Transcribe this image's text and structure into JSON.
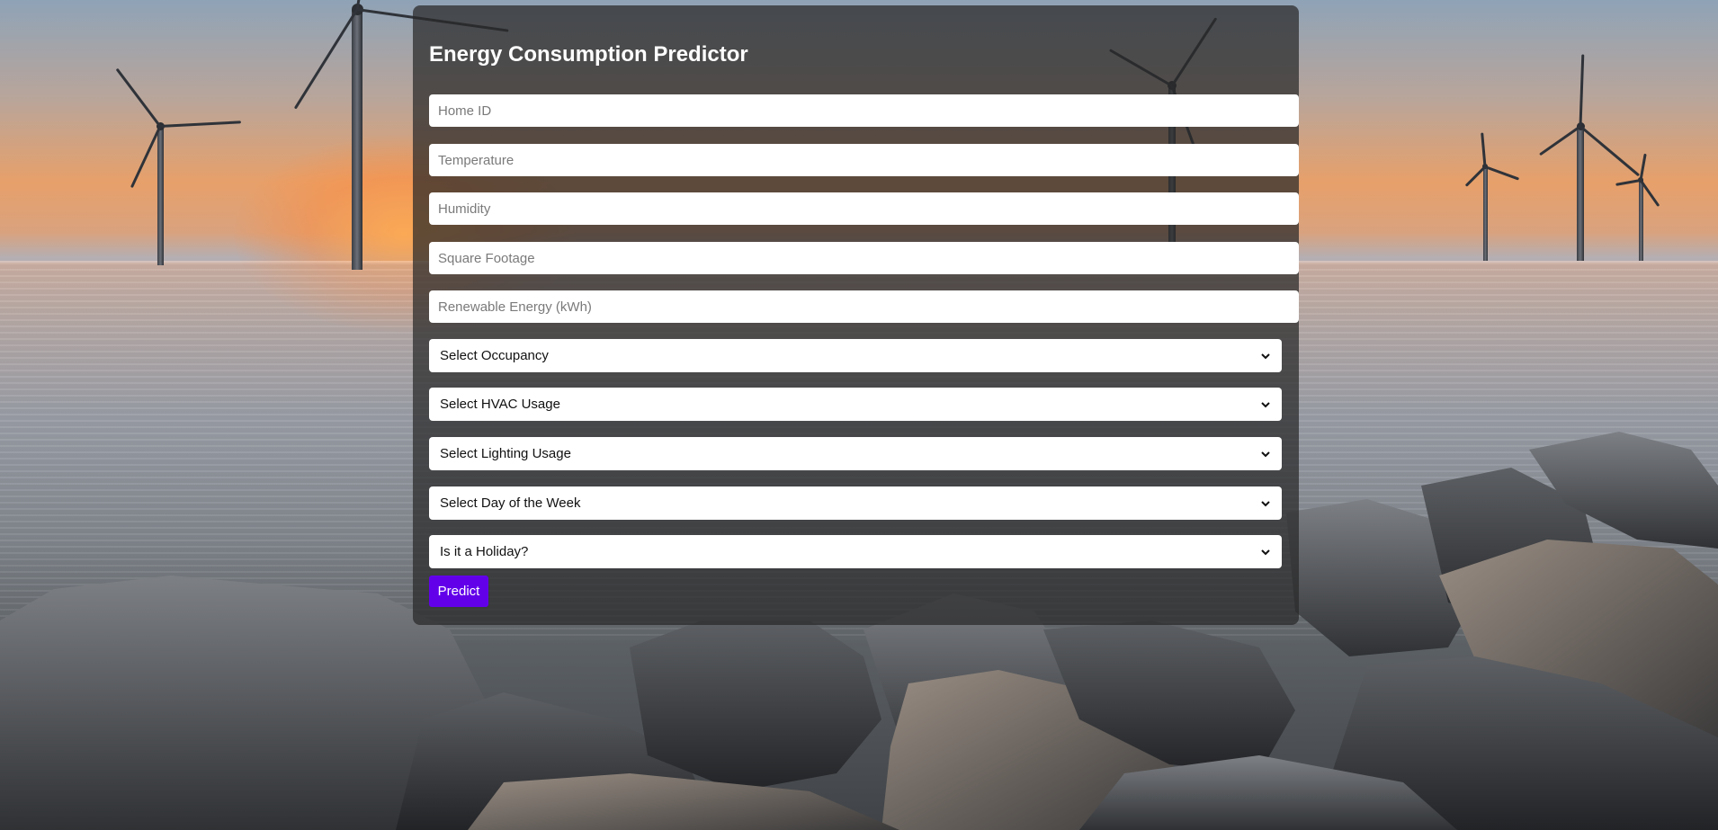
{
  "form": {
    "title": "Energy Consumption Predictor",
    "inputs": [
      {
        "placeholder": "Home ID",
        "value": ""
      },
      {
        "placeholder": "Temperature",
        "value": ""
      },
      {
        "placeholder": "Humidity",
        "value": ""
      },
      {
        "placeholder": "Square Footage",
        "value": ""
      },
      {
        "placeholder": "Renewable Energy (kWh)",
        "value": ""
      }
    ],
    "selects": [
      {
        "selected": "Select Occupancy"
      },
      {
        "selected": "Select HVAC Usage"
      },
      {
        "selected": "Select Lighting Usage"
      },
      {
        "selected": "Select Day of the Week"
      },
      {
        "selected": "Is it a Holiday?"
      }
    ],
    "submit_label": "Predict"
  },
  "colors": {
    "button": "#6200ea",
    "panel": "rgba(40,40,40,0.72)",
    "title": "#ffffff"
  },
  "background": {
    "icon": "offshore-wind-turbines-rocks-sunset-image"
  }
}
